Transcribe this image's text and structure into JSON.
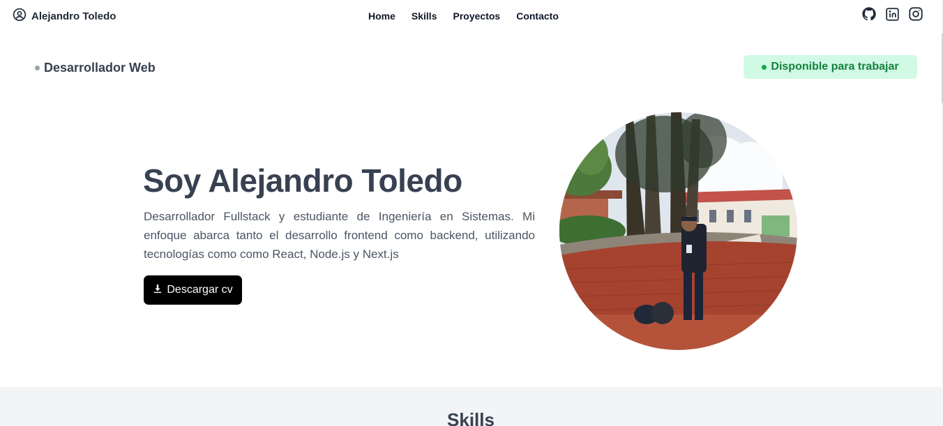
{
  "header": {
    "brand_icon": "user-circle-icon",
    "brand_name": "Alejandro Toledo",
    "nav": [
      {
        "label": "Home"
      },
      {
        "label": "Skills"
      },
      {
        "label": "Proyectos"
      },
      {
        "label": "Contacto"
      }
    ],
    "social_icons": [
      "github-icon",
      "linkedin-icon",
      "instagram-icon"
    ]
  },
  "hero": {
    "role": "Desarrollador Web",
    "availability": "Disponible para trabajar",
    "title": "Soy Alejandro Toledo",
    "description": "Desarrollador Fullstack y estudiante de Ingeniería en Sistemas. Mi enfoque abarca tanto el desarrollo frontend como backend, utilizando tecnologías como como React, Node.js y Next.js",
    "cv_button": "Descargar cv",
    "cv_icon": "download-icon"
  },
  "skills": {
    "title": "Skills"
  },
  "colors": {
    "availability_bg": "#d1fae5",
    "availability_text": "#15803d",
    "button_bg": "#000000",
    "title_text": "#374151",
    "section_bg": "#f3f4f6"
  }
}
